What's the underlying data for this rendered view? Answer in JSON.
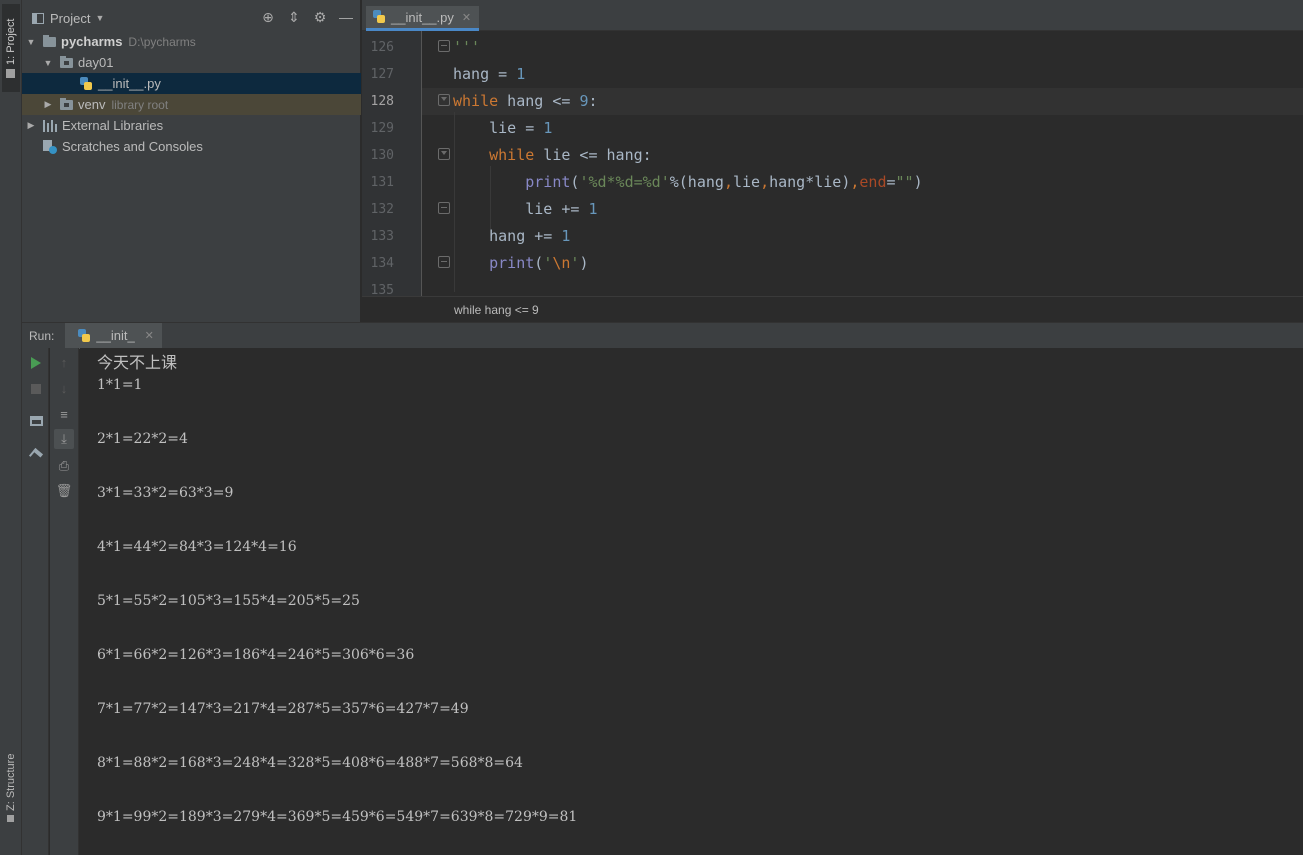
{
  "side_strip": {
    "project_tab": "1: Project",
    "structure_tab": "Z: Structure"
  },
  "project_panel": {
    "title": "Project",
    "tree": [
      {
        "label": "pycharms",
        "hint": "D:\\pycharms"
      },
      {
        "label": "day01"
      },
      {
        "label": "__init__.py"
      },
      {
        "label": "venv",
        "hint": "library root"
      },
      {
        "label": "External Libraries"
      },
      {
        "label": "Scratches and Consoles"
      }
    ]
  },
  "editor": {
    "tab_label": "__init__.py",
    "line_numbers": [
      "126",
      "127",
      "128",
      "129",
      "130",
      "131",
      "132",
      "133",
      "134",
      "135"
    ],
    "current_line": "128",
    "code_lines": [
      "'''",
      "hang = 1",
      "while hang <= 9:",
      "    lie = 1",
      "    while lie <= hang:",
      "        print('%d*%d=%d'%(hang,lie,hang*lie),end=\"\")",
      "        lie += 1",
      "    hang += 1",
      "    print('\\n')",
      ""
    ],
    "breadcrumb": "while hang <= 9"
  },
  "run_panel": {
    "label": "Run:",
    "tab_label": "__init_",
    "output_lines": [
      "今天不上课",
      "1*1=1",
      "",
      "2*1=22*2=4",
      "",
      "3*1=33*2=63*3=9",
      "",
      "4*1=44*2=84*3=124*4=16",
      "",
      "5*1=55*2=105*3=155*4=205*5=25",
      "",
      "6*1=66*2=126*3=186*4=246*5=306*6=36",
      "",
      "7*1=77*2=147*3=217*4=287*5=357*6=427*7=49",
      "",
      "8*1=88*2=168*3=248*4=328*5=408*6=488*7=568*8=64",
      "",
      "9*1=99*2=189*3=279*4=369*5=459*6=549*7=639*8=729*9=81"
    ]
  }
}
